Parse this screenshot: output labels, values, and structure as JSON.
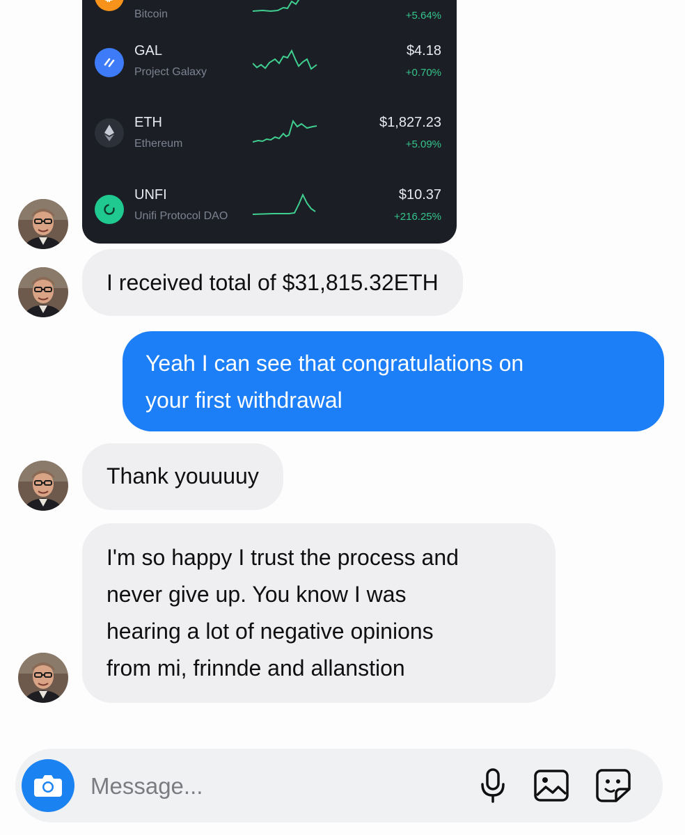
{
  "crypto_card": {
    "coins": [
      {
        "symbol": "",
        "name": "Bitcoin",
        "price": "",
        "change": "+5.64%",
        "icon": "bitcoin-icon",
        "icon_color": "#f7931a"
      },
      {
        "symbol": "GAL",
        "name": "Project Galaxy",
        "price": "$4.18",
        "change": "+0.70%",
        "icon": "project-galaxy-icon",
        "icon_color": "#3e7bf8"
      },
      {
        "symbol": "ETH",
        "name": "Ethereum",
        "price": "$1,827.23",
        "change": "+5.09%",
        "icon": "ethereum-icon",
        "icon_color": "#2c3038"
      },
      {
        "symbol": "UNFI",
        "name": "Unifi Protocol DAO",
        "price": "$10.37",
        "change": "+216.25%",
        "icon": "unifi-icon",
        "icon_color": "#1fc98f"
      }
    ],
    "positive_color": "#35c48b"
  },
  "messages": [
    {
      "direction": "incoming",
      "text": "I received total of $31,815.32ETH"
    },
    {
      "direction": "outgoing",
      "lines": [
        "Yeah I can see that congratulations on",
        "your first withdrawal"
      ]
    },
    {
      "direction": "incoming",
      "text": "Thank youuuuy"
    },
    {
      "direction": "incoming",
      "lines": [
        "I'm so happy I trust the process and",
        "never give up. You know I was",
        "hearing a lot of negative opinions",
        "from mi, frinnde and allanstion"
      ]
    }
  ],
  "composer": {
    "placeholder": "Message...",
    "icons": [
      "camera-icon",
      "microphone-icon",
      "gallery-icon",
      "sticker-icon"
    ]
  },
  "colors": {
    "outgoing_bubble": "#1d7ff7",
    "incoming_bubble": "#efeff1",
    "camera_button": "#1b82f2"
  }
}
